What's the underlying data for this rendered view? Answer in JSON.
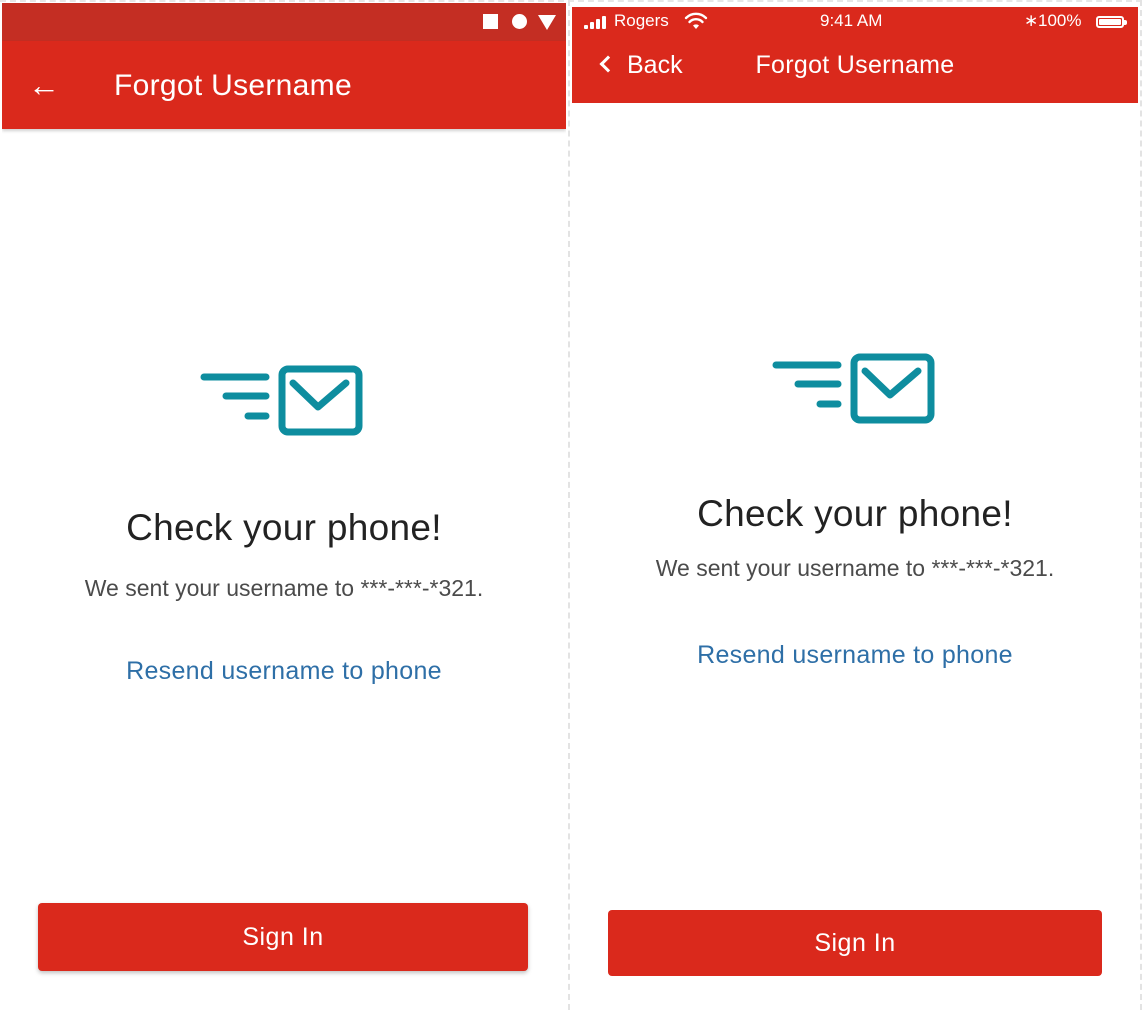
{
  "colors": {
    "brand_red": "#da291c",
    "status_bar_red": "#c42e23",
    "icon_teal": "#0e8d9f",
    "link_blue": "#2e6fa7"
  },
  "android": {
    "status_icons": [
      "stop-square-icon",
      "home-circle-icon",
      "back-triangle-icon"
    ],
    "app_bar": {
      "back_icon": "arrow-left-icon",
      "back_glyph": "←",
      "title": "Forgot Username"
    },
    "content": {
      "illustration_icon": "mail-sent-icon",
      "heading": "Check your phone!",
      "message": "We sent your username to ***-***-*321.",
      "resend_link": "Resend username to phone",
      "sign_in_button": "Sign In"
    }
  },
  "ios": {
    "status_bar": {
      "carrier": "Rogers",
      "time": "9:41 AM",
      "bluetooth_glyph": "∗",
      "battery_percent": "100%"
    },
    "nav_bar": {
      "back_label": "Back",
      "title": "Forgot Username"
    },
    "content": {
      "illustration_icon": "mail-sent-icon",
      "heading": "Check your phone!",
      "message": "We sent your username to ***-***-*321.",
      "resend_link": "Resend username to phone",
      "sign_in_button": "Sign In"
    }
  }
}
